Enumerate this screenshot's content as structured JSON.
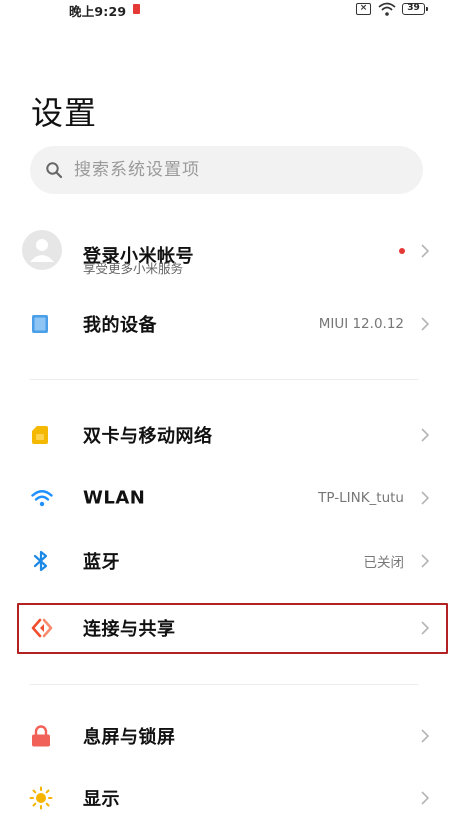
{
  "status_bar": {
    "time": "晚上9:29",
    "sim_label": "×",
    "battery": "39"
  },
  "page": {
    "title": "设置"
  },
  "search": {
    "placeholder": "搜索系统设置项",
    "value": ""
  },
  "account": {
    "label": "登录小米帐号",
    "sublabel": "享受更多小米服务"
  },
  "settings": {
    "my_device": {
      "label": "我的设备",
      "value": "MIUI 12.0.12"
    },
    "sim": {
      "label": "双卡与移动网络",
      "value": ""
    },
    "wlan": {
      "label": "WLAN",
      "value": "TP-LINK_tutu"
    },
    "bluetooth": {
      "label": "蓝牙",
      "value": "已关闭"
    },
    "connection": {
      "label": "连接与共享",
      "value": ""
    },
    "lock_screen": {
      "label": "息屏与锁屏",
      "value": ""
    },
    "display": {
      "label": "显示",
      "value": ""
    }
  },
  "colors": {
    "device_icon": "#4a9fe8",
    "sim_icon": "#f5b800",
    "wifi_icon": "#1e90ff",
    "bluetooth_icon": "#1e88e5",
    "connection_icon": "#f04e2e",
    "lock_icon": "#f26157",
    "display_icon": "#f5b400",
    "highlight_border": "#b22222",
    "notification_dot": "#e53935"
  }
}
